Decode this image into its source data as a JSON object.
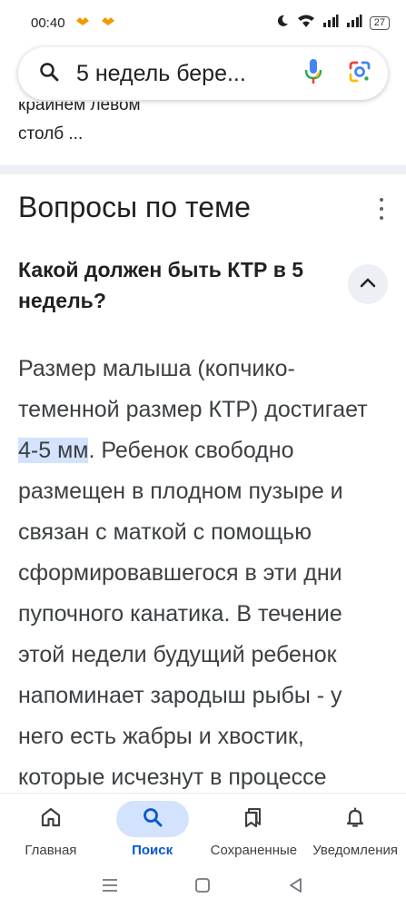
{
  "status_bar": {
    "time": "00:40",
    "battery": "27",
    "icons": [
      "app-notification-icon",
      "app-notification-icon",
      "moon-icon",
      "wifi-icon",
      "signal-icon",
      "signal-icon",
      "battery-icon"
    ]
  },
  "search": {
    "query": "5 недель бере...",
    "icons": [
      "search-icon",
      "microphone-icon",
      "google-lens-icon"
    ]
  },
  "snippet": {
    "line_partial": "крайнем левом",
    "line": "столб ..."
  },
  "related": {
    "title": "Вопросы по теме",
    "question": "Какой должен быть КТР в 5 недель?",
    "answer_before": "Размер малыша (копчико-теменной размер КТР) достигает ",
    "answer_highlight": "4-5 мм",
    "answer_after": ". Ребенок свободно размещен в плодном пузыре и связан с маткой с помощью сформировавшегося в эти дни пупочного канатика. В течение этой недели будущий ребенок напоминает зародыш рыбы - у него есть жабры и хвостик, которые исчезнут в процессе"
  },
  "bottom_nav": {
    "items": [
      {
        "label": "Главная",
        "icon": "home-icon",
        "active": false
      },
      {
        "label": "Поиск",
        "icon": "search-icon",
        "active": true
      },
      {
        "label": "Сохраненные",
        "icon": "bookmarks-icon",
        "active": false
      },
      {
        "label": "Уведомления",
        "icon": "bell-icon",
        "active": false
      }
    ]
  },
  "colors": {
    "accent": "#0b57d0",
    "active_pill": "#d3e3fd",
    "divider": "#eceff3",
    "mic_blue": "#4285f4",
    "mic_red": "#ea4335"
  }
}
